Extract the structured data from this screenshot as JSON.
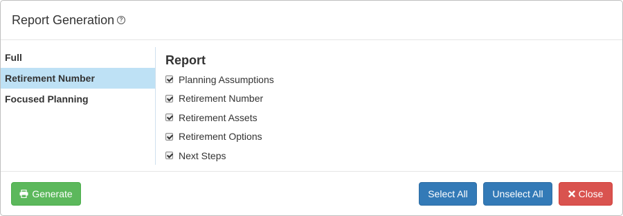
{
  "header": {
    "title": "Report Generation",
    "help_icon": "?"
  },
  "sidebar": {
    "items": [
      {
        "label": "Full",
        "active": false
      },
      {
        "label": "Retirement Number",
        "active": true
      },
      {
        "label": "Focused Planning",
        "active": false
      }
    ]
  },
  "content": {
    "title": "Report",
    "options": [
      {
        "label": "Planning Assumptions",
        "checked": true
      },
      {
        "label": "Retirement Number",
        "checked": true
      },
      {
        "label": "Retirement Assets",
        "checked": true
      },
      {
        "label": "Retirement Options",
        "checked": true
      },
      {
        "label": "Next Steps",
        "checked": true
      }
    ]
  },
  "footer": {
    "generate_label": "Generate",
    "generate_icon": "printer-icon",
    "select_all_label": "Select All",
    "unselect_all_label": "Unselect All",
    "close_label": "Close",
    "close_icon": "close-icon"
  },
  "colors": {
    "success": "#5cb85c",
    "primary": "#337ab7",
    "danger": "#d9534f",
    "active_item": "#bee1f5"
  }
}
